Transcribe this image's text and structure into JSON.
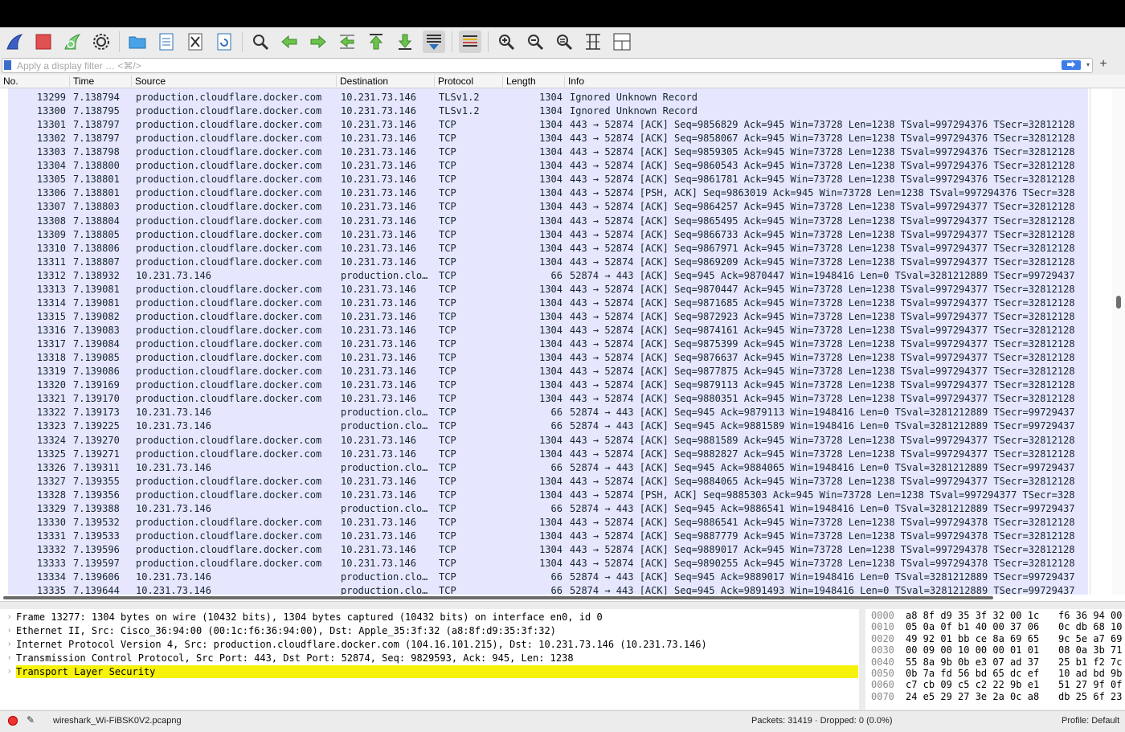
{
  "toolbar": {
    "buttons": [
      "shark-fin-start-icon",
      "stop-square-icon",
      "restart-fin-icon",
      "capture-options-gear-icon",
      "open-folder-icon",
      "save-file-icon",
      "close-file-icon",
      "reload-file-icon",
      "find-packet-icon",
      "go-back-icon",
      "go-forward-icon",
      "go-to-packet-icon",
      "go-first-icon",
      "go-last-icon",
      "autoscroll-icon",
      "colorize-icon",
      "zoom-in-icon",
      "zoom-out-icon",
      "zoom-normal-icon",
      "resize-columns-icon",
      "layout-panes-icon"
    ]
  },
  "filter": {
    "placeholder": "Apply a display filter … <⌘/>",
    "apply_arrow": "⮕",
    "dropdown": "▾",
    "add": "+"
  },
  "columns": [
    "No.",
    "Time",
    "Source",
    "Destination",
    "Protocol",
    "Length",
    "Info"
  ],
  "packets": [
    [
      "13299",
      "7.138794",
      "production.cloudflare.docker.com",
      "10.231.73.146",
      "TLSv1.2",
      "1304",
      "Ignored Unknown Record"
    ],
    [
      "13300",
      "7.138795",
      "production.cloudflare.docker.com",
      "10.231.73.146",
      "TLSv1.2",
      "1304",
      "Ignored Unknown Record"
    ],
    [
      "13301",
      "7.138797",
      "production.cloudflare.docker.com",
      "10.231.73.146",
      "TCP",
      "1304",
      "443 → 52874 [ACK] Seq=9856829 Ack=945 Win=73728 Len=1238 TSval=997294376 TSecr=32812128"
    ],
    [
      "13302",
      "7.138797",
      "production.cloudflare.docker.com",
      "10.231.73.146",
      "TCP",
      "1304",
      "443 → 52874 [ACK] Seq=9858067 Ack=945 Win=73728 Len=1238 TSval=997294376 TSecr=32812128"
    ],
    [
      "13303",
      "7.138798",
      "production.cloudflare.docker.com",
      "10.231.73.146",
      "TCP",
      "1304",
      "443 → 52874 [ACK] Seq=9859305 Ack=945 Win=73728 Len=1238 TSval=997294376 TSecr=32812128"
    ],
    [
      "13304",
      "7.138800",
      "production.cloudflare.docker.com",
      "10.231.73.146",
      "TCP",
      "1304",
      "443 → 52874 [ACK] Seq=9860543 Ack=945 Win=73728 Len=1238 TSval=997294376 TSecr=32812128"
    ],
    [
      "13305",
      "7.138801",
      "production.cloudflare.docker.com",
      "10.231.73.146",
      "TCP",
      "1304",
      "443 → 52874 [ACK] Seq=9861781 Ack=945 Win=73728 Len=1238 TSval=997294376 TSecr=32812128"
    ],
    [
      "13306",
      "7.138801",
      "production.cloudflare.docker.com",
      "10.231.73.146",
      "TCP",
      "1304",
      "443 → 52874 [PSH, ACK] Seq=9863019 Ack=945 Win=73728 Len=1238 TSval=997294376 TSecr=328"
    ],
    [
      "13307",
      "7.138803",
      "production.cloudflare.docker.com",
      "10.231.73.146",
      "TCP",
      "1304",
      "443 → 52874 [ACK] Seq=9864257 Ack=945 Win=73728 Len=1238 TSval=997294377 TSecr=32812128"
    ],
    [
      "13308",
      "7.138804",
      "production.cloudflare.docker.com",
      "10.231.73.146",
      "TCP",
      "1304",
      "443 → 52874 [ACK] Seq=9865495 Ack=945 Win=73728 Len=1238 TSval=997294377 TSecr=32812128"
    ],
    [
      "13309",
      "7.138805",
      "production.cloudflare.docker.com",
      "10.231.73.146",
      "TCP",
      "1304",
      "443 → 52874 [ACK] Seq=9866733 Ack=945 Win=73728 Len=1238 TSval=997294377 TSecr=32812128"
    ],
    [
      "13310",
      "7.138806",
      "production.cloudflare.docker.com",
      "10.231.73.146",
      "TCP",
      "1304",
      "443 → 52874 [ACK] Seq=9867971 Ack=945 Win=73728 Len=1238 TSval=997294377 TSecr=32812128"
    ],
    [
      "13311",
      "7.138807",
      "production.cloudflare.docker.com",
      "10.231.73.146",
      "TCP",
      "1304",
      "443 → 52874 [ACK] Seq=9869209 Ack=945 Win=73728 Len=1238 TSval=997294377 TSecr=32812128"
    ],
    [
      "13312",
      "7.138932",
      "10.231.73.146",
      "production.clo…",
      "TCP",
      "66",
      "52874 → 443 [ACK] Seq=945 Ack=9870447 Win=1948416 Len=0 TSval=3281212889 TSecr=99729437"
    ],
    [
      "13313",
      "7.139081",
      "production.cloudflare.docker.com",
      "10.231.73.146",
      "TCP",
      "1304",
      "443 → 52874 [ACK] Seq=9870447 Ack=945 Win=73728 Len=1238 TSval=997294377 TSecr=32812128"
    ],
    [
      "13314",
      "7.139081",
      "production.cloudflare.docker.com",
      "10.231.73.146",
      "TCP",
      "1304",
      "443 → 52874 [ACK] Seq=9871685 Ack=945 Win=73728 Len=1238 TSval=997294377 TSecr=32812128"
    ],
    [
      "13315",
      "7.139082",
      "production.cloudflare.docker.com",
      "10.231.73.146",
      "TCP",
      "1304",
      "443 → 52874 [ACK] Seq=9872923 Ack=945 Win=73728 Len=1238 TSval=997294377 TSecr=32812128"
    ],
    [
      "13316",
      "7.139083",
      "production.cloudflare.docker.com",
      "10.231.73.146",
      "TCP",
      "1304",
      "443 → 52874 [ACK] Seq=9874161 Ack=945 Win=73728 Len=1238 TSval=997294377 TSecr=32812128"
    ],
    [
      "13317",
      "7.139084",
      "production.cloudflare.docker.com",
      "10.231.73.146",
      "TCP",
      "1304",
      "443 → 52874 [ACK] Seq=9875399 Ack=945 Win=73728 Len=1238 TSval=997294377 TSecr=32812128"
    ],
    [
      "13318",
      "7.139085",
      "production.cloudflare.docker.com",
      "10.231.73.146",
      "TCP",
      "1304",
      "443 → 52874 [ACK] Seq=9876637 Ack=945 Win=73728 Len=1238 TSval=997294377 TSecr=32812128"
    ],
    [
      "13319",
      "7.139086",
      "production.cloudflare.docker.com",
      "10.231.73.146",
      "TCP",
      "1304",
      "443 → 52874 [ACK] Seq=9877875 Ack=945 Win=73728 Len=1238 TSval=997294377 TSecr=32812128"
    ],
    [
      "13320",
      "7.139169",
      "production.cloudflare.docker.com",
      "10.231.73.146",
      "TCP",
      "1304",
      "443 → 52874 [ACK] Seq=9879113 Ack=945 Win=73728 Len=1238 TSval=997294377 TSecr=32812128"
    ],
    [
      "13321",
      "7.139170",
      "production.cloudflare.docker.com",
      "10.231.73.146",
      "TCP",
      "1304",
      "443 → 52874 [ACK] Seq=9880351 Ack=945 Win=73728 Len=1238 TSval=997294377 TSecr=32812128"
    ],
    [
      "13322",
      "7.139173",
      "10.231.73.146",
      "production.clo…",
      "TCP",
      "66",
      "52874 → 443 [ACK] Seq=945 Ack=9879113 Win=1948416 Len=0 TSval=3281212889 TSecr=99729437"
    ],
    [
      "13323",
      "7.139225",
      "10.231.73.146",
      "production.clo…",
      "TCP",
      "66",
      "52874 → 443 [ACK] Seq=945 Ack=9881589 Win=1948416 Len=0 TSval=3281212889 TSecr=99729437"
    ],
    [
      "13324",
      "7.139270",
      "production.cloudflare.docker.com",
      "10.231.73.146",
      "TCP",
      "1304",
      "443 → 52874 [ACK] Seq=9881589 Ack=945 Win=73728 Len=1238 TSval=997294377 TSecr=32812128"
    ],
    [
      "13325",
      "7.139271",
      "production.cloudflare.docker.com",
      "10.231.73.146",
      "TCP",
      "1304",
      "443 → 52874 [ACK] Seq=9882827 Ack=945 Win=73728 Len=1238 TSval=997294377 TSecr=32812128"
    ],
    [
      "13326",
      "7.139311",
      "10.231.73.146",
      "production.clo…",
      "TCP",
      "66",
      "52874 → 443 [ACK] Seq=945 Ack=9884065 Win=1948416 Len=0 TSval=3281212889 TSecr=99729437"
    ],
    [
      "13327",
      "7.139355",
      "production.cloudflare.docker.com",
      "10.231.73.146",
      "TCP",
      "1304",
      "443 → 52874 [ACK] Seq=9884065 Ack=945 Win=73728 Len=1238 TSval=997294377 TSecr=32812128"
    ],
    [
      "13328",
      "7.139356",
      "production.cloudflare.docker.com",
      "10.231.73.146",
      "TCP",
      "1304",
      "443 → 52874 [PSH, ACK] Seq=9885303 Ack=945 Win=73728 Len=1238 TSval=997294377 TSecr=328"
    ],
    [
      "13329",
      "7.139388",
      "10.231.73.146",
      "production.clo…",
      "TCP",
      "66",
      "52874 → 443 [ACK] Seq=945 Ack=9886541 Win=1948416 Len=0 TSval=3281212889 TSecr=99729437"
    ],
    [
      "13330",
      "7.139532",
      "production.cloudflare.docker.com",
      "10.231.73.146",
      "TCP",
      "1304",
      "443 → 52874 [ACK] Seq=9886541 Ack=945 Win=73728 Len=1238 TSval=997294378 TSecr=32812128"
    ],
    [
      "13331",
      "7.139533",
      "production.cloudflare.docker.com",
      "10.231.73.146",
      "TCP",
      "1304",
      "443 → 52874 [ACK] Seq=9887779 Ack=945 Win=73728 Len=1238 TSval=997294378 TSecr=32812128"
    ],
    [
      "13332",
      "7.139596",
      "production.cloudflare.docker.com",
      "10.231.73.146",
      "TCP",
      "1304",
      "443 → 52874 [ACK] Seq=9889017 Ack=945 Win=73728 Len=1238 TSval=997294378 TSecr=32812128"
    ],
    [
      "13333",
      "7.139597",
      "production.cloudflare.docker.com",
      "10.231.73.146",
      "TCP",
      "1304",
      "443 → 52874 [ACK] Seq=9890255 Ack=945 Win=73728 Len=1238 TSval=997294378 TSecr=32812128"
    ],
    [
      "13334",
      "7.139606",
      "10.231.73.146",
      "production.clo…",
      "TCP",
      "66",
      "52874 → 443 [ACK] Seq=945 Ack=9889017 Win=1948416 Len=0 TSval=3281212889 TSecr=99729437"
    ],
    [
      "13335",
      "7.139644",
      "10.231.73.146",
      "production.clo…",
      "TCP",
      "66",
      "52874 → 443 [ACK] Seq=945 Ack=9891493 Win=1948416 Len=0 TSval=3281212889 TSecr=99729437"
    ]
  ],
  "details": [
    "Frame 13277: 1304 bytes on wire (10432 bits), 1304 bytes captured (10432 bits) on interface en0, id 0",
    "Ethernet II, Src: Cisco_36:94:00 (00:1c:f6:36:94:00), Dst: Apple_35:3f:32 (a8:8f:d9:35:3f:32)",
    "Internet Protocol Version 4, Src: production.cloudflare.docker.com (104.16.101.215), Dst: 10.231.73.146 (10.231.73.146)",
    "Transmission Control Protocol, Src Port: 443, Dst Port: 52874, Seq: 9829593, Ack: 945, Len: 1238",
    "Transport Layer Security"
  ],
  "details_selected_index": 4,
  "bytes": [
    [
      "0000",
      "a8 8f d9 35 3f 32 00 1c",
      "f6 36 94 00"
    ],
    [
      "0010",
      "05 0a 0f b1 40 00 37 06",
      "0c db 68 10"
    ],
    [
      "0020",
      "49 92 01 bb ce 8a 69 65",
      "9c 5e a7 69"
    ],
    [
      "0030",
      "00 09 00 10 00 00 01 01",
      "08 0a 3b 71"
    ],
    [
      "0040",
      "55 8a 9b 0b e3 07 ad 37",
      "25 b1 f2 7c"
    ],
    [
      "0050",
      "0b 7a fd 56 bd 65 dc ef",
      "10 ad bd 9b"
    ],
    [
      "0060",
      "c7 cb 09 c5 c2 22 9b e1",
      "51 27 9f 0f"
    ],
    [
      "0070",
      "24 e5 29 27 3e 2a 0c a8",
      "db 25 6f 23"
    ]
  ],
  "status": {
    "file": "wireshark_Wi-FiBSK0V2.pcapng",
    "packets": "Packets: 31419 · Dropped: 0 (0.0%)",
    "profile": "Profile: Default"
  },
  "colors": {
    "row_bg": "#e7e6ff",
    "row_text": "#12272e",
    "selected_detail": "#f6f20a",
    "stop_red": "#e33333",
    "accent_blue": "#3f7ee8"
  }
}
